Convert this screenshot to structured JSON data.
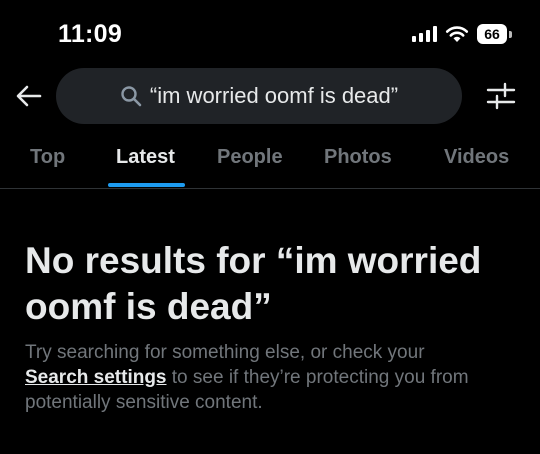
{
  "status_bar": {
    "time": "11:09",
    "battery": "66"
  },
  "search": {
    "query": "“im worried oomf is dead”"
  },
  "tabs": [
    {
      "label": "Top",
      "active": false
    },
    {
      "label": "Latest",
      "active": true
    },
    {
      "label": "People",
      "active": false
    },
    {
      "label": "Photos",
      "active": false
    },
    {
      "label": "Videos",
      "active": false
    }
  ],
  "empty_state": {
    "title": "No results for “im worried oomf is dead”",
    "body_before": "Try searching for something else, or check your",
    "link_label": "Search settings",
    "body_after": "to see if they’re protecting you from potentially sensitive content."
  },
  "colors": {
    "background": "#000000",
    "search_bg": "#202327",
    "accent": "#1d9bf0",
    "muted_text": "#71767b"
  },
  "icons": [
    "wifi-icon",
    "back-arrow-icon",
    "search-icon",
    "filter-sliders-icon"
  ]
}
